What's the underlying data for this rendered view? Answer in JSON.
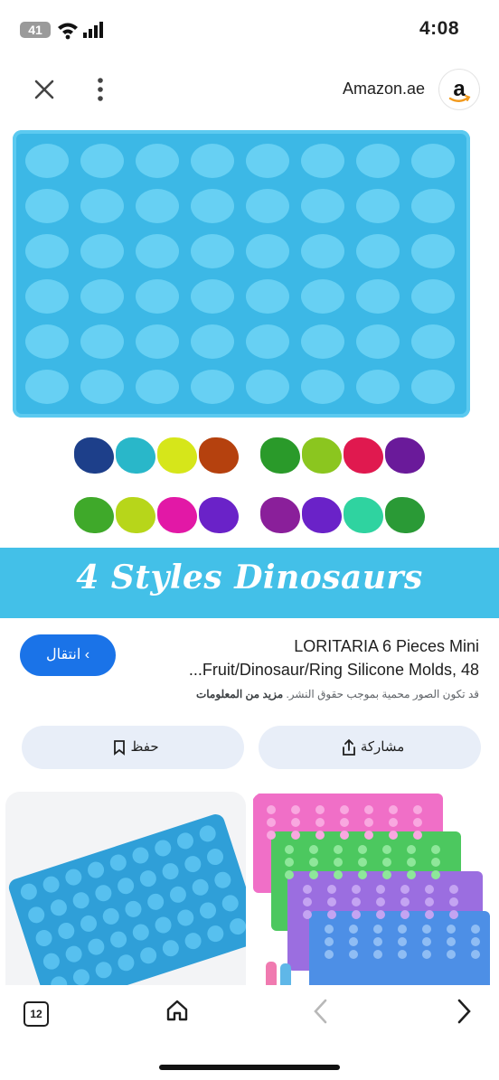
{
  "status_bar": {
    "battery": "41",
    "time": "4:08"
  },
  "top_bar": {
    "domain": "Amazon.ae",
    "site_icon": "amazon-logo"
  },
  "hero_image": {
    "banner_text": "4 Styles Dinosaurs"
  },
  "result": {
    "visit_button_label": "انتقال ‹",
    "title_line1": "LORITARIA 6 Pieces Mini",
    "title_line2": "...Fruit/Dinosaur/Ring Silicone Molds, 48",
    "copyright_text": "قد تكون الصور محمية بموجب حقوق النشر.",
    "copyright_link": "مزيد من المعلومات"
  },
  "actions": {
    "share_label": "مشاركة",
    "save_label": "حفظ"
  },
  "bottom_nav": {
    "tab_count": "12"
  },
  "colors": {
    "accent": "#1a73e8",
    "pill_bg": "#e8eef8",
    "banner": "#43c0e8",
    "tray": "#3cb8e6"
  }
}
